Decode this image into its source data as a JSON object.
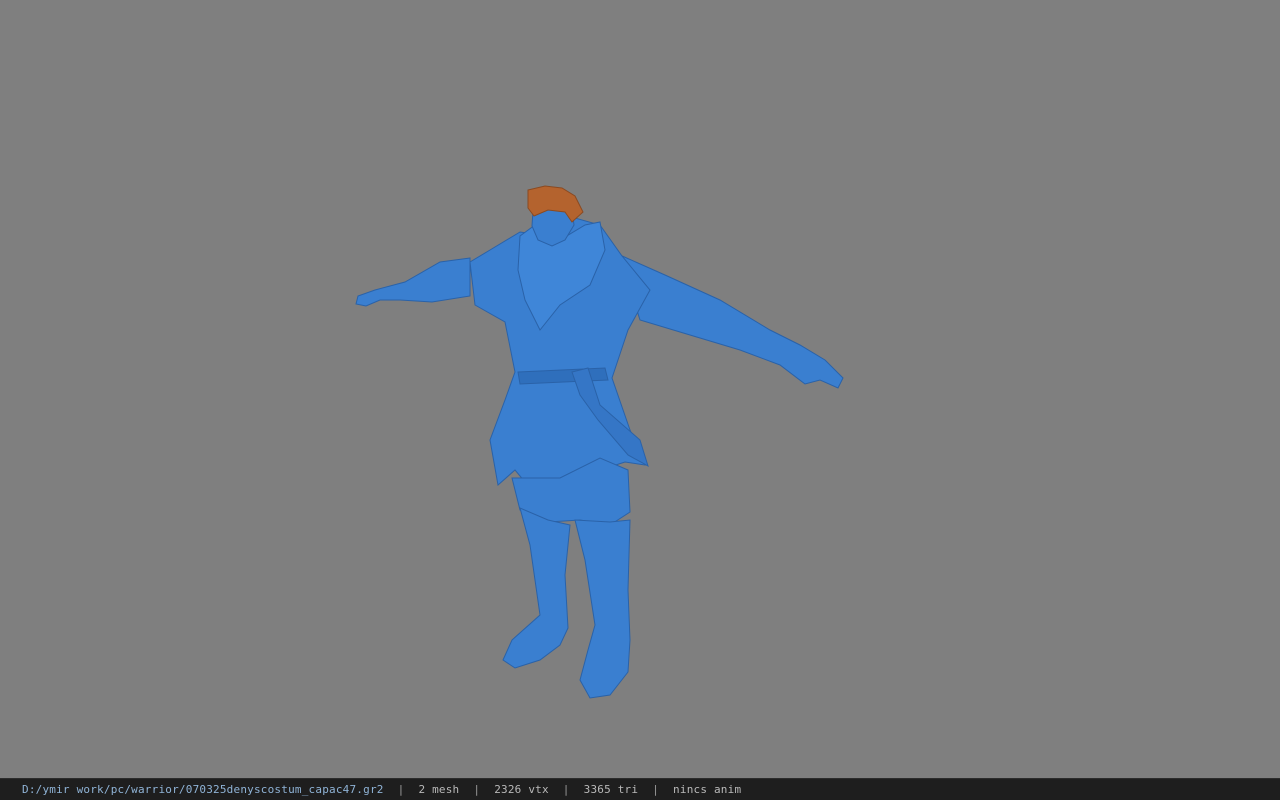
{
  "viewport": {
    "background": "#7f7f7f",
    "model": {
      "body_color": "#3a7fd0",
      "body_shadow": "#2a62a8",
      "hair_color": "#b4632e"
    }
  },
  "status_bar": {
    "file_path": "D:/ymir work/pc/warrior/070325denyscostum_capac47.gr2",
    "separator": "|",
    "mesh": "2 mesh",
    "vertices": "2326 vtx",
    "triangles": "3365 tri",
    "anim": "nincs anim"
  }
}
